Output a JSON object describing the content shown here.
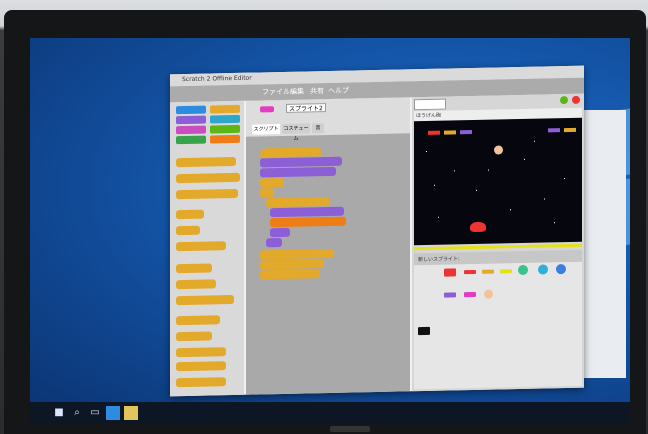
{
  "scene": {
    "description_colors": {
      "screen": "#1455a8",
      "scratch_bg": "#f1f1f1",
      "block_orange": "#e3a92a",
      "block_purple": "#8c5fd6",
      "block_blue": "#2d8ce0",
      "stage": "#05060e"
    }
  },
  "scratch": {
    "title": "Scratch 2 Offline Editor",
    "menu": [
      "ファイル",
      "編集",
      "共有",
      "ヘルプ"
    ],
    "sprite_name": "スプライト2",
    "tabs": [
      "スクリプト",
      "コスチューム",
      "音"
    ],
    "stage_label": "ほうげん砲",
    "sprite_panel_label": "新しいスプライト:"
  },
  "taskbar": {
    "icons": [
      "windows-icon",
      "search-icon",
      "task-view-icon",
      "app-icon",
      "folder-icon"
    ]
  }
}
